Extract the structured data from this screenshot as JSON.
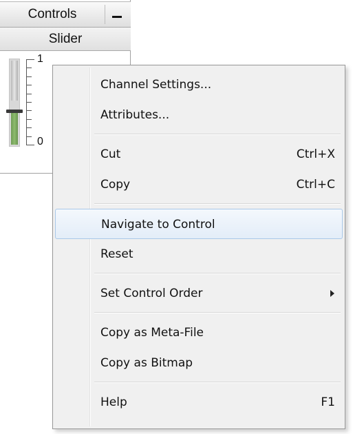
{
  "panel": {
    "title": "Controls",
    "minimize_icon": "minimize-icon",
    "slider_caption": "Slider",
    "slider": {
      "value": 0.4,
      "max_label": "1",
      "min_label": "0",
      "fill_color": "#8dbb6e"
    }
  },
  "context_menu": {
    "groups": [
      {
        "items": [
          {
            "label": "Channel Settings...",
            "shortcut": ""
          },
          {
            "label": "Attributes...",
            "shortcut": ""
          }
        ]
      },
      {
        "items": [
          {
            "label": "Cut",
            "shortcut": "Ctrl+X"
          },
          {
            "label": "Copy",
            "shortcut": "Ctrl+C"
          }
        ]
      },
      {
        "items": [
          {
            "label": "Navigate to Control",
            "shortcut": "",
            "highlighted": true
          },
          {
            "label": "Reset",
            "shortcut": ""
          }
        ]
      },
      {
        "items": [
          {
            "label": "Set Control Order",
            "shortcut": "",
            "submenu": true
          }
        ]
      },
      {
        "items": [
          {
            "label": "Copy as Meta-File",
            "shortcut": ""
          },
          {
            "label": "Copy as Bitmap",
            "shortcut": ""
          }
        ]
      },
      {
        "items": [
          {
            "label": "Help",
            "shortcut": "F1"
          }
        ]
      }
    ],
    "highlight_color": "#e3edf8",
    "highlight_border": "#a9c8e8"
  }
}
